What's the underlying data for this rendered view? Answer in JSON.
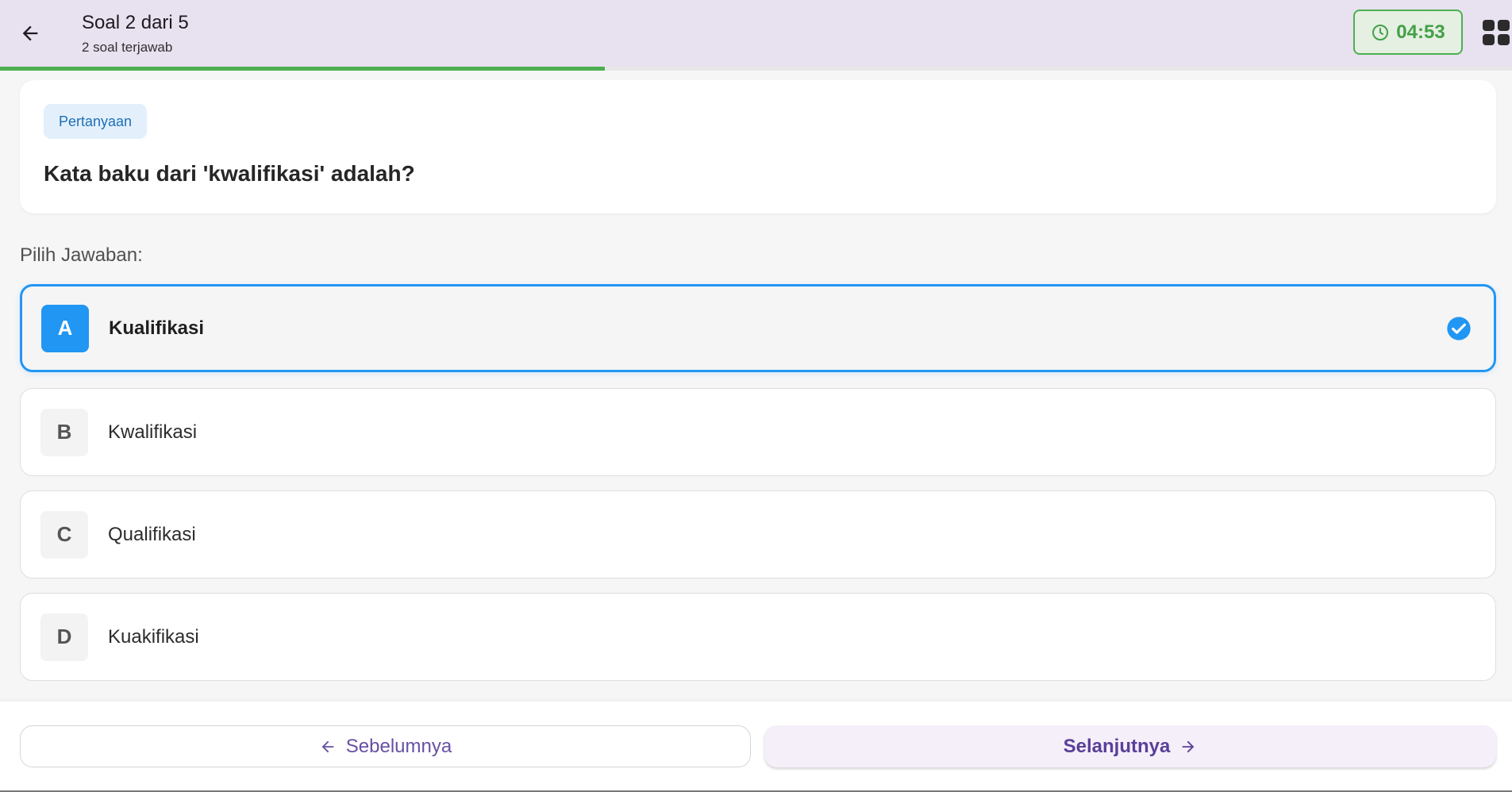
{
  "header": {
    "title": "Soal 2 dari 5",
    "subtitle": "2 soal terjawab",
    "timer": "04:53",
    "progress_fraction": 0.4
  },
  "question": {
    "tag": "Pertanyaan",
    "text": "Kata baku dari 'kwalifikasi' adalah?"
  },
  "choose_label": "Pilih Jawaban:",
  "options": [
    {
      "letter": "A",
      "text": "Kualifikasi",
      "selected": true
    },
    {
      "letter": "B",
      "text": "Kwalifikasi",
      "selected": false
    },
    {
      "letter": "C",
      "text": "Qualifikasi",
      "selected": false
    },
    {
      "letter": "D",
      "text": "Kuakifikasi",
      "selected": false
    }
  ],
  "footer": {
    "prev_label": "Sebelumnya",
    "next_label": "Selanjutnya"
  },
  "colors": {
    "header_bg": "#e8e1ef",
    "progress": "#4caf50",
    "selected": "#2196f3",
    "primary": "#6750a4",
    "timer": "#43a047"
  }
}
